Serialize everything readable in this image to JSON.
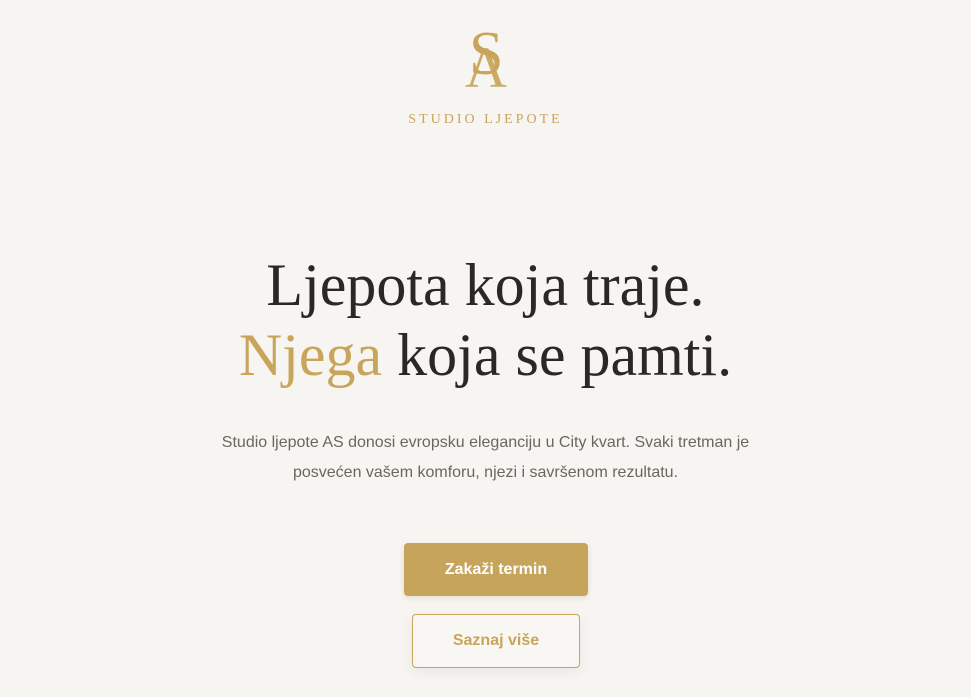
{
  "brand": {
    "monogram": "AS",
    "name": "STUDIO LJEPOTE",
    "accent_color": "#c9a55c"
  },
  "hero": {
    "line1": "Ljepota koja traje.",
    "line2_accent": "Njega",
    "line2_rest": " koja se pamti.",
    "lead_line1": "Studio ljepote AS donosi evropsku eleganciju u City kvart. Svaki tretman je",
    "lead_line2": "posvećen vašem komforu, njezi i savršenom rezultatu."
  },
  "actions": {
    "primary_label": "Zakaži termin",
    "secondary_label": "Saznaj više"
  }
}
